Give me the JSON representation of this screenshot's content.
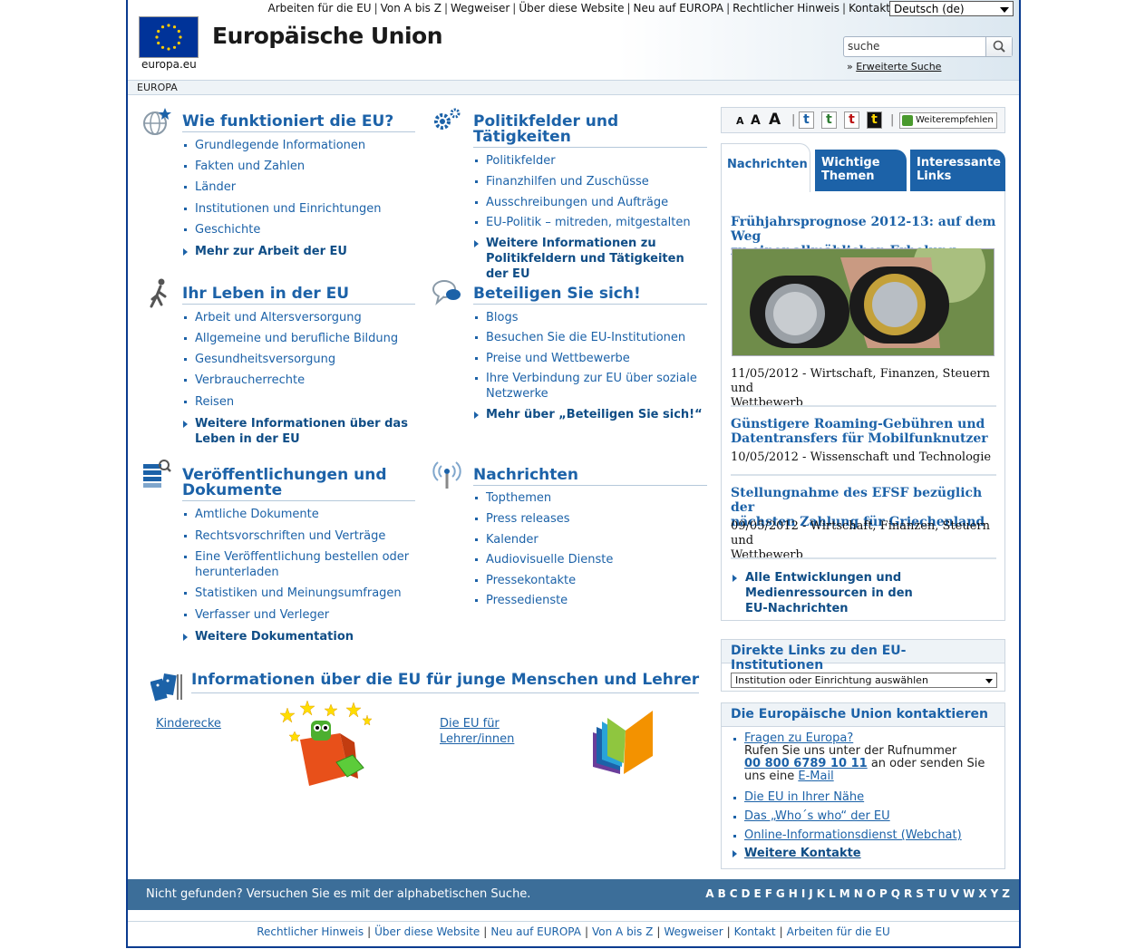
{
  "header": {
    "top_links": [
      "Arbeiten für die EU",
      "Von A bis Z",
      "Wegweiser",
      "Über diese Website",
      "Neu auf EUROPA",
      "Rechtlicher Hinweis",
      "Kontakt"
    ],
    "language": "Deutsch (de)",
    "logo_text": "europa.eu",
    "site_title": "Europäische Union",
    "search_value": "suche",
    "advanced_search": "Erweiterte Suche",
    "breadcrumb": "EUROPA"
  },
  "sections": {
    "how": {
      "title": "Wie funktioniert die EU?",
      "items": [
        "Grundlegende Informationen",
        "Fakten und Zahlen",
        "Länder",
        "Institutionen und Einrichtungen",
        "Geschichte"
      ],
      "more": "Mehr zur Arbeit der EU"
    },
    "policy": {
      "title_1": "Politikfelder und",
      "title_2": "Tätigkeiten",
      "items": [
        "Politikfelder",
        "Finanzhilfen und Zuschüsse",
        "Ausschreibungen und Aufträge",
        "EU-Politik – mitreden, mitgestalten"
      ],
      "more_1": "Weitere Informationen zu",
      "more_2": "Politikfeldern und Tätigkeiten der EU"
    },
    "life": {
      "title": "Ihr Leben in der EU",
      "items": [
        "Arbeit und Altersversorgung",
        "Allgemeine und berufliche Bildung",
        "Gesundheitsversorgung",
        "Verbraucherrechte",
        "Reisen"
      ],
      "more_1": "Weitere Informationen über das",
      "more_2": "Leben in der EU"
    },
    "participate": {
      "title": "Beteiligen Sie sich!",
      "items": [
        "Blogs",
        "Besuchen Sie die EU-Institutionen",
        "Preise und Wettbewerbe"
      ],
      "item_social_1": "Ihre Verbindung zur EU über soziale",
      "item_social_2": "Netzwerke",
      "more": "Mehr über „Beteiligen Sie sich!“"
    },
    "publications": {
      "title_1": "Veröffentlichungen und",
      "title_2": "Dokumente",
      "items_a": [
        "Amtliche Dokumente",
        "Rechtsvorschriften und Verträge"
      ],
      "order_1": "Eine Veröffentlichung bestellen oder",
      "order_2": "herunterladen",
      "items_b": [
        "Statistiken und Meinungsumfragen",
        "Verfasser und Verleger"
      ],
      "more": "Weitere Dokumentation"
    },
    "news": {
      "title": "Nachrichten",
      "items": [
        "Topthemen",
        "Press releases",
        "Kalender",
        "Audiovisuelle Dienste",
        "Pressekontakte",
        "Pressedienste"
      ]
    }
  },
  "young": {
    "title": "Informationen über die EU für junge Menschen und Lehrer",
    "kids": "Kinderecke",
    "teachers_1": "Die EU für",
    "teachers_2": "Lehrer/innen"
  },
  "tools": {
    "a1": "A",
    "a2": "A",
    "a3": "A",
    "t": "t",
    "recommend": "Weiterempfehlen"
  },
  "tabs": {
    "news": "Nachrichten",
    "topics_1": "Wichtige",
    "topics_2": "Themen",
    "links_1": "Interessante",
    "links_2": "Links"
  },
  "newsitems": [
    {
      "title_1": "Frühjahrsprognose 2012-13: auf dem Weg",
      "title_2": "zu einer allmählichen Erholung",
      "meta_1": "11/05/2012 - Wirtschaft, Finanzen, Steuern und",
      "meta_2": "Wettbewerb"
    },
    {
      "title_1": "Günstigere Roaming-Gebühren und",
      "title_2": "Datentransfers für Mobilfunknutzer",
      "meta_1": "10/05/2012 - Wissenschaft und Technologie"
    },
    {
      "title_1": "Stellungnahme des EFSF bezüglich der",
      "title_2": "nächsten Zahlung für Griechenland",
      "meta_1": "09/05/2012 - Wirtschaft, Finanzen, Steuern und",
      "meta_2": "Wettbewerb"
    }
  ],
  "news_more": {
    "l1": "Alle Entwicklungen und",
    "l2": "Medienressourcen in den",
    "l3": "EU-Nachrichten"
  },
  "institutions": {
    "title": "Direkte Links zu den EU-Institutionen",
    "select": "Institution oder Einrichtung auswählen"
  },
  "contact": {
    "title": "Die Europäische Union kontaktieren",
    "q": "Fragen zu Europa?",
    "call_1": "Rufen Sie uns unter der Rufnummer",
    "phone": "00 800 6789 10 11",
    "call_2": "an oder senden Sie",
    "call_3": "uns eine",
    "email": "E-Mail",
    "links": [
      "Die EU in Ihrer Nähe",
      "Das „Who´s who“ der EU",
      "Online-Informationsdienst (Webchat)"
    ],
    "more": "Weitere Kontakte"
  },
  "bottom": {
    "not_found": "Nicht gefunden? Versuchen Sie es mit der alphabetischen Suche.",
    "letters": [
      "A",
      "B",
      "C",
      "D",
      "E",
      "F",
      "G",
      "H",
      "I",
      "J",
      "K",
      "L",
      "M",
      "N",
      "O",
      "P",
      "Q",
      "R",
      "S",
      "T",
      "U",
      "V",
      "W",
      "X",
      "Y",
      "Z"
    ]
  },
  "footer": [
    "Rechtlicher Hinweis",
    "Über diese Website",
    "Neu auf EUROPA",
    "Von A bis Z",
    "Wegweiser",
    "Kontakt",
    "Arbeiten für die EU"
  ],
  "colors": {
    "primary": "#1c62a8",
    "frame": "#0a3b8f",
    "bottom_bar": "#3c6e99"
  }
}
